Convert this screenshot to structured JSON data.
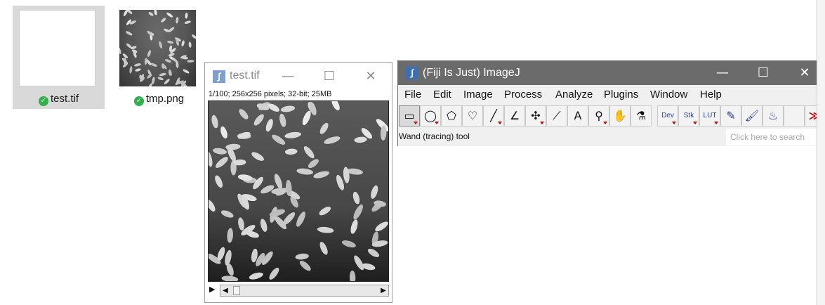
{
  "desktop": {
    "files": [
      {
        "name": "test.tif",
        "status_icon": "check-icon",
        "selected": true
      },
      {
        "name": "tmp.png",
        "status_icon": "check-icon",
        "selected": false
      }
    ]
  },
  "image_window": {
    "title": "test.tif",
    "info": "1/100; 256x256 pixels; 32-bit; 25MB",
    "minimize": "—",
    "maximize": "☐",
    "close": "✕",
    "play_glyph": "▶",
    "scroll_left": "◀",
    "scroll_right": "▶"
  },
  "imagej": {
    "title": "(Fiji Is Just) ImageJ",
    "minimize": "—",
    "maximize": "☐",
    "close": "✕",
    "menus": [
      "File",
      "Edit",
      "Image",
      "Process",
      "Analyze",
      "Plugins",
      "Window",
      "Help"
    ],
    "tools": [
      {
        "name": "rectangle-tool",
        "glyph": "▭"
      },
      {
        "name": "oval-tool",
        "glyph": "◯"
      },
      {
        "name": "polygon-tool",
        "glyph": "⬠"
      },
      {
        "name": "freehand-tool",
        "glyph": "♡"
      },
      {
        "name": "line-tool",
        "glyph": "╱"
      },
      {
        "name": "angle-tool",
        "glyph": "∠"
      },
      {
        "name": "point-tool",
        "glyph": "✣"
      },
      {
        "name": "wand-tool",
        "glyph": "⟋"
      },
      {
        "name": "text-tool",
        "glyph": "A"
      },
      {
        "name": "magnifier-tool",
        "glyph": "⚲"
      },
      {
        "name": "hand-tool",
        "glyph": "✋"
      },
      {
        "name": "color-picker-tool",
        "glyph": "⚗"
      },
      {
        "name": "dev-tool",
        "glyph": "Dev"
      },
      {
        "name": "stk-tool",
        "glyph": "Stk"
      },
      {
        "name": "lut-tool",
        "glyph": "LUT"
      },
      {
        "name": "pencil-tool",
        "glyph": "✎"
      },
      {
        "name": "brush-tool",
        "glyph": "🖌"
      },
      {
        "name": "flood-fill-tool",
        "glyph": "♨"
      },
      {
        "name": "blank-tool",
        "glyph": ""
      },
      {
        "name": "more-tools",
        "glyph": "≫"
      }
    ],
    "status": "Wand (tracing) tool",
    "search_placeholder": "Click here to search"
  }
}
